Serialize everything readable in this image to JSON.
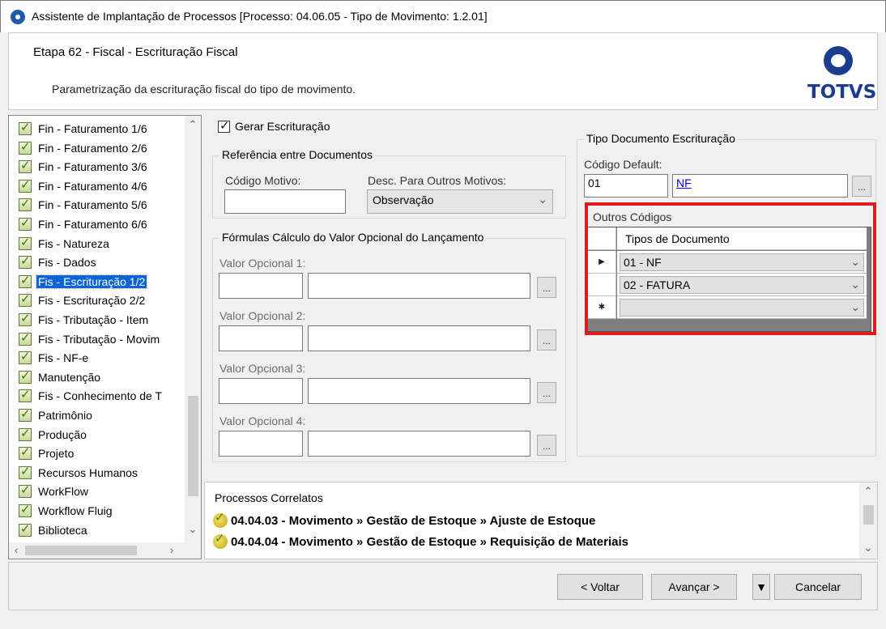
{
  "window": {
    "title": "Assistente de Implantação de Processos [Processo: 04.06.05 - Tipo de Movimento: 1.2.01]"
  },
  "header": {
    "step_title": "Etapa 62 - Fiscal - Escrituração Fiscal",
    "description": "Parametrização da escrituração fiscal do tipo de movimento.",
    "logo_text": "TOTVS"
  },
  "tree": {
    "items": [
      {
        "label": "Fin - Faturamento 1/6"
      },
      {
        "label": "Fin - Faturamento 2/6"
      },
      {
        "label": "Fin - Faturamento 3/6"
      },
      {
        "label": "Fin - Faturamento 4/6"
      },
      {
        "label": "Fin - Faturamento 5/6"
      },
      {
        "label": "Fin - Faturamento 6/6"
      },
      {
        "label": "Fis - Natureza"
      },
      {
        "label": "Fis - Dados"
      },
      {
        "label": "Fis - Escrituração 1/2"
      },
      {
        "label": "Fis - Escrituração 2/2"
      },
      {
        "label": "Fis - Tributação - Item"
      },
      {
        "label": "Fis - Tributação - Movim"
      },
      {
        "label": "Fis - NF-e"
      },
      {
        "label": "Manutenção"
      },
      {
        "label": "Fis - Conhecimento de T"
      },
      {
        "label": "Patrimônio"
      },
      {
        "label": "Produção"
      },
      {
        "label": "Projeto"
      },
      {
        "label": "Recursos Humanos"
      },
      {
        "label": "WorkFlow"
      },
      {
        "label": "Workflow Fluig"
      },
      {
        "label": "Biblioteca"
      }
    ],
    "selected_index": 8
  },
  "form": {
    "gerar_escrituracao": {
      "label": "Gerar Escrituração",
      "checked": true
    },
    "referencia": {
      "group_label": "Referência entre Documentos",
      "codigo_motivo_label": "Código Motivo:",
      "codigo_motivo_value": "",
      "desc_label": "Desc. Para Outros Motivos:",
      "desc_value": "Observação"
    },
    "formulas": {
      "group_label": "Fórmulas Cálculo do Valor Opcional do Lançamento",
      "fields": [
        {
          "label": "Valor Opcional 1:"
        },
        {
          "label": "Valor Opcional 2:"
        },
        {
          "label": "Valor Opcional 3:"
        },
        {
          "label": "Valor Opcional 4:"
        }
      ],
      "ellipsis": "..."
    },
    "tipo_documento": {
      "group_label": "Tipo Documento Escrituração",
      "codigo_default_label": "Código Default:",
      "codigo_value": "01",
      "link_value": "NF",
      "ellipsis": "..."
    },
    "outros_codigos": {
      "group_label": "Outros Códigos",
      "column_header": "Tipos de Documento",
      "rows": [
        {
          "marker": "▶",
          "value": "01 - NF"
        },
        {
          "marker": "",
          "value": "02 - FATURA"
        },
        {
          "marker": "✱",
          "value": ""
        }
      ]
    }
  },
  "correlatos": {
    "title": "Processos Correlatos",
    "items": [
      {
        "text": "04.04.03 - Movimento » Gestão de Estoque » Ajuste de Estoque"
      },
      {
        "text": "04.04.04 - Movimento » Gestão de Estoque » Requisição de Materiais"
      }
    ]
  },
  "footer": {
    "voltar": "< Voltar",
    "avancar": "Avançar >",
    "cancelar": "Cancelar"
  }
}
